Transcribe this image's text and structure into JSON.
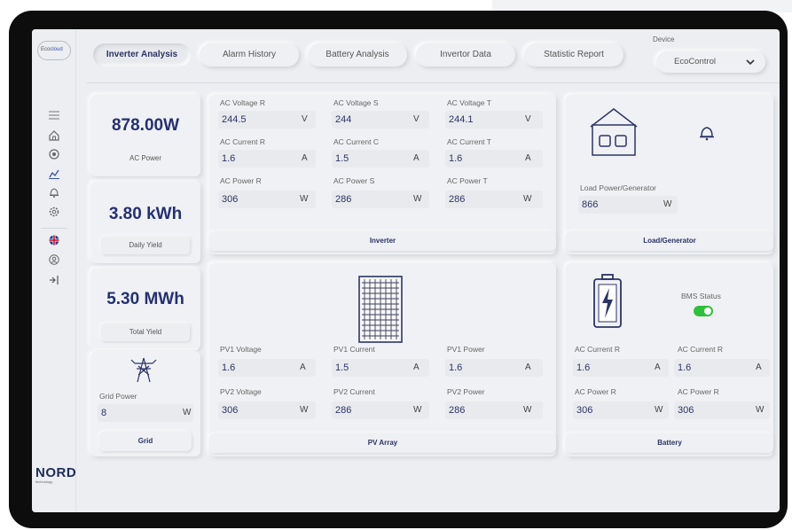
{
  "logo": {
    "text_a": "Eco",
    "text_b": "cloud"
  },
  "tabs": [
    {
      "label": "Inverter Analysis"
    },
    {
      "label": "Alarm History"
    },
    {
      "label": "Battery Analysis"
    },
    {
      "label": "Invertor Data"
    },
    {
      "label": "Statistic Report"
    }
  ],
  "device": {
    "label": "Device",
    "value": "EcoControl"
  },
  "sidebar": {
    "icons": [
      "menu-icon",
      "home-icon",
      "radar-icon",
      "chart-icon",
      "bell-icon",
      "settings-icon",
      "flag-uk-icon",
      "user-icon",
      "logout-icon"
    ],
    "brand": "NORD",
    "brand_sub": "technology"
  },
  "summary": {
    "ac_power": {
      "value": "878.00W",
      "label": "AC Power"
    },
    "daily_yield": {
      "value": "3.80 kWh",
      "label": "Daily Yield"
    },
    "total_yield": {
      "value": "5.30 MWh",
      "label": "Total Yield"
    },
    "grid": {
      "field_label": "Grid Power",
      "value": "8",
      "unit": "W",
      "footer": "Grid"
    }
  },
  "inverter": {
    "footer": "Inverter",
    "fields": [
      {
        "label": "AC Voltage R",
        "value": "244.5",
        "unit": "V"
      },
      {
        "label": "AC Voltage S",
        "value": "244",
        "unit": "V"
      },
      {
        "label": "AC Voltage T",
        "value": "244.1",
        "unit": "V"
      },
      {
        "label": "AC Current R",
        "value": "1.6",
        "unit": "A"
      },
      {
        "label": "AC Current C",
        "value": "1.5",
        "unit": "A"
      },
      {
        "label": "AC Current T",
        "value": "1.6",
        "unit": "A"
      },
      {
        "label": "AC Power R",
        "value": "306",
        "unit": "W"
      },
      {
        "label": "AC Power S",
        "value": "286",
        "unit": "W"
      },
      {
        "label": "AC Power T",
        "value": "286",
        "unit": "W"
      }
    ]
  },
  "load": {
    "footer": "Load/Generator",
    "field": {
      "label": "Load Power/Generator",
      "value": "866",
      "unit": "W"
    }
  },
  "pv": {
    "footer": "PV Array",
    "fields": [
      {
        "label": "PV1 Voltage",
        "value": "1.6",
        "unit": "A"
      },
      {
        "label": "PV1 Current",
        "value": "1.5",
        "unit": "A"
      },
      {
        "label": "PV1 Power",
        "value": "1.6",
        "unit": "A"
      },
      {
        "label": "PV2 Voltage",
        "value": "306",
        "unit": "W"
      },
      {
        "label": "PV2 Current",
        "value": "286",
        "unit": "W"
      },
      {
        "label": "PV2 Power",
        "value": "286",
        "unit": "W"
      }
    ]
  },
  "battery": {
    "footer": "Battery",
    "bms_label": "BMS Status",
    "bms_on": true,
    "fields": [
      {
        "label": "AC Current R",
        "value": "1.6",
        "unit": "A"
      },
      {
        "label": "AC Current R",
        "value": "1.6",
        "unit": "A"
      },
      {
        "label": "AC Power R",
        "value": "306",
        "unit": "W"
      },
      {
        "label": "AC Power R",
        "value": "306",
        "unit": "W"
      }
    ]
  },
  "colors": {
    "accent": "#243073",
    "toggle_on": "#2ec13c",
    "flag": "#c8102e"
  }
}
